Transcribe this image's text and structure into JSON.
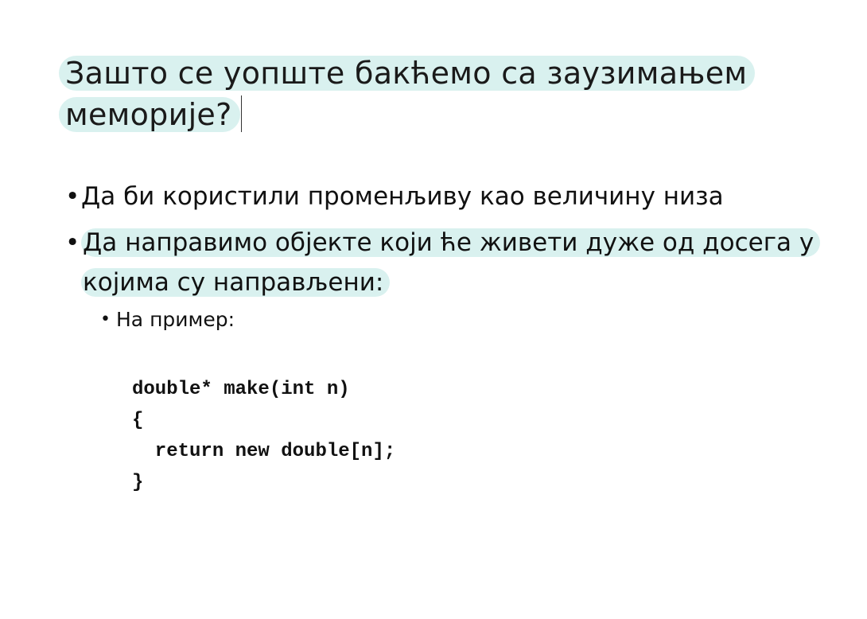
{
  "slide": {
    "title": "Зашто се уопште бакћемо са заузимањем меморије?",
    "bullets": [
      "Да би користили променљиву као величину низа",
      "Да направимо објекте који ће живети дуже од досега у којима су направљени:"
    ],
    "sub_bullet": "На пример:",
    "bullet_glyph": "•",
    "code_lines": [
      "double* make(int n)",
      "{",
      "  return new double[n];",
      "}"
    ],
    "colors": {
      "highlight": "#d9f1ef",
      "text": "#111111",
      "background": "#ffffff"
    }
  }
}
